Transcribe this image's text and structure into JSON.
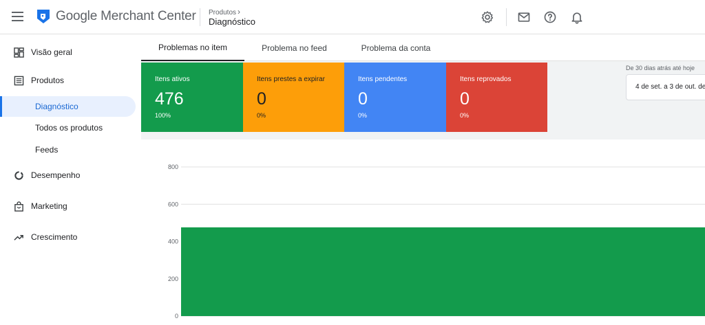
{
  "header": {
    "brand": "Google Merchant Center",
    "breadcrumb_parent": "Produtos",
    "breadcrumb_current": "Diagnóstico",
    "icons": [
      "settings-icon",
      "mail-icon",
      "help-icon",
      "notifications-icon"
    ]
  },
  "sidebar": {
    "items": [
      {
        "label": "Visão geral",
        "icon": "dashboard-icon"
      },
      {
        "label": "Produtos",
        "icon": "list-icon"
      },
      {
        "label": "Diagnóstico"
      },
      {
        "label": "Todos os produtos"
      },
      {
        "label": "Feeds"
      },
      {
        "label": "Desempenho",
        "icon": "donut-icon"
      },
      {
        "label": "Marketing",
        "icon": "bag-icon"
      },
      {
        "label": "Crescimento",
        "icon": "trending-up-icon"
      }
    ]
  },
  "tabs": [
    {
      "label": "Problemas no item",
      "active": true
    },
    {
      "label": "Problema no feed"
    },
    {
      "label": "Problema da conta"
    }
  ],
  "cards": [
    {
      "title": "Itens ativos",
      "value": "476",
      "percent": "100%",
      "color": "#139b4c",
      "text_color": "#ffffff"
    },
    {
      "title": "Itens prestes a expirar",
      "value": "0",
      "percent": "0%",
      "color": "#fd9e09",
      "text_color": "#202124"
    },
    {
      "title": "Itens pendentes",
      "value": "0",
      "percent": "0%",
      "color": "#4285f4",
      "text_color": "#ffffff"
    },
    {
      "title": "Itens reprovados",
      "value": "0",
      "percent": "0%",
      "color": "#db4437",
      "text_color": "#ffffff"
    }
  ],
  "date_range": {
    "label": "De 30 dias atrás até hoje",
    "value": "4 de set. a 3 de out. de"
  },
  "chart_data": {
    "type": "area",
    "yticks": [
      "800",
      "600",
      "400",
      "200",
      "0"
    ],
    "ylim": [
      0,
      800
    ],
    "series": [
      {
        "values": [
          476,
          476
        ]
      }
    ],
    "fill_color": "#139b4c",
    "grid": true
  }
}
